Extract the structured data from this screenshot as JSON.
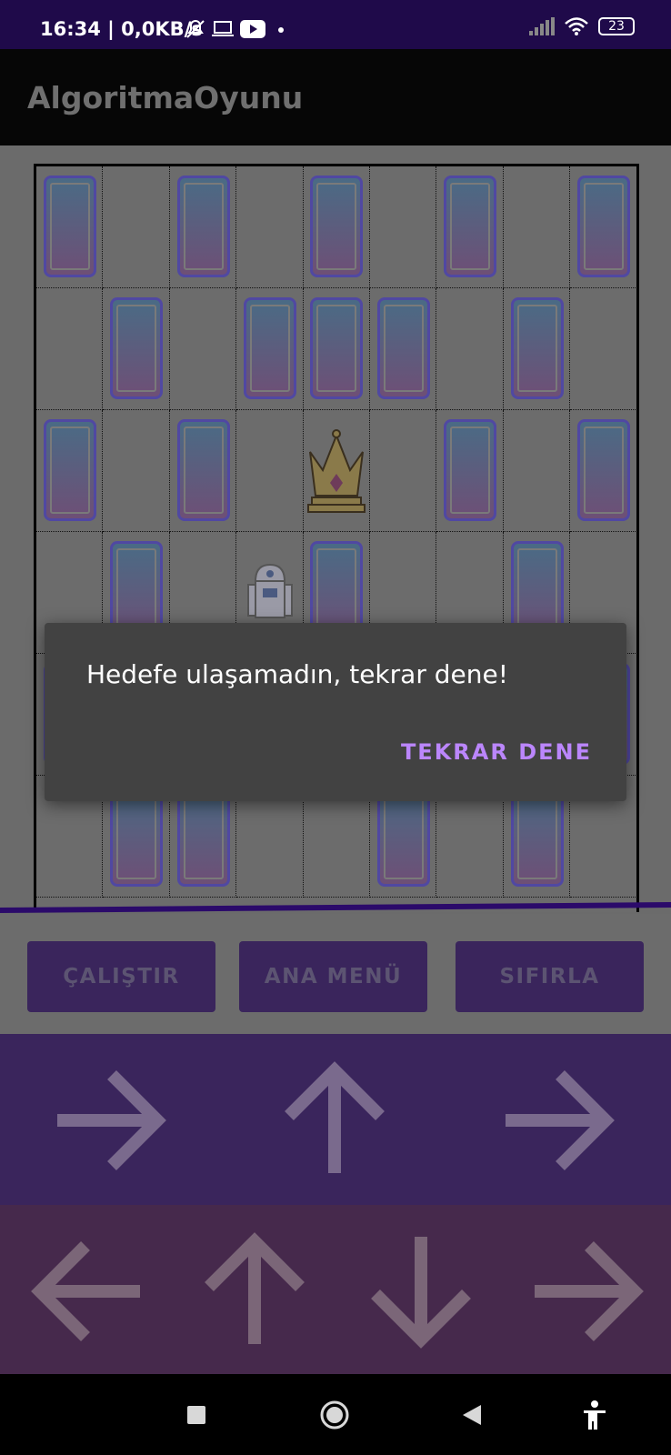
{
  "status_bar": {
    "time": "16:34 | 0,0KB/s",
    "battery": "23",
    "icons": [
      "muted-bell-icon",
      "laptop-icon",
      "youtube-icon",
      "dot-icon",
      "signal-icon",
      "wifi-icon",
      "battery-icon"
    ]
  },
  "app_bar": {
    "title": "AlgoritmaOyunu"
  },
  "board": {
    "columns": 9,
    "rows": 6,
    "cards": [
      [
        0,
        0
      ],
      [
        0,
        2
      ],
      [
        0,
        4
      ],
      [
        0,
        6
      ],
      [
        0,
        8
      ],
      [
        1,
        1
      ],
      [
        1,
        3
      ],
      [
        1,
        4
      ],
      [
        1,
        5
      ],
      [
        1,
        7
      ],
      [
        2,
        0
      ],
      [
        2,
        2
      ],
      [
        2,
        6
      ],
      [
        2,
        8
      ],
      [
        3,
        1
      ],
      [
        3,
        4
      ],
      [
        3,
        7
      ],
      [
        4,
        0
      ],
      [
        4,
        8
      ],
      [
        5,
        1
      ],
      [
        5,
        2
      ],
      [
        5,
        5
      ],
      [
        5,
        7
      ]
    ],
    "crown": [
      2,
      4
    ],
    "robot": [
      3,
      3
    ],
    "icons": [
      "card-icon",
      "crown-icon",
      "robot-icon"
    ]
  },
  "buttons": {
    "run": "ÇALIŞTIR",
    "menu": "ANA MENÜ",
    "reset": "SIFIRLA"
  },
  "program_arrows": [
    "right",
    "up",
    "right"
  ],
  "palette_arrows": [
    "left",
    "up",
    "down",
    "right"
  ],
  "dialog": {
    "message": "Hedefe ulaşamadın, tekrar dene!",
    "action": "TEKRAR DENE"
  },
  "nav_icons": [
    "square-icon",
    "circle-icon",
    "back-triangle-icon",
    "accessibility-icon"
  ],
  "colors": {
    "accent": "#bb86fc",
    "button_bg": "#3a255c",
    "dialog_bg": "#424242",
    "status_bar": "#1f0a4a"
  }
}
